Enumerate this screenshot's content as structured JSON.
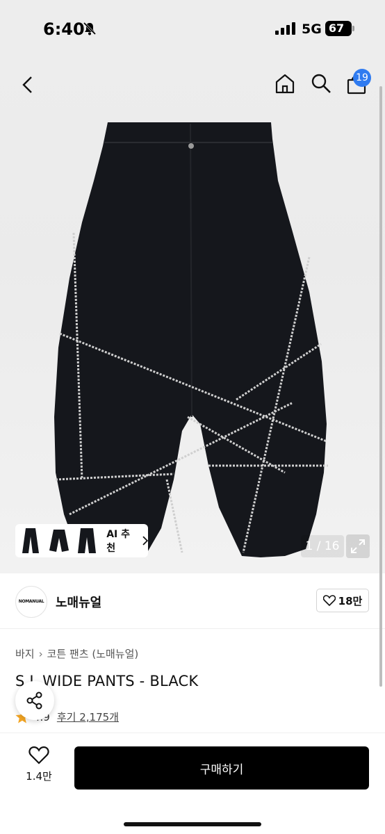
{
  "status": {
    "time": "6:40",
    "network": "5G",
    "battery": "67",
    "battery_level": 0.67
  },
  "header": {
    "cart_count": "19"
  },
  "gallery": {
    "ai_label": "AI 추천",
    "page_indicator": "1 / 16"
  },
  "brand": {
    "name": "노매뉴얼",
    "logo_text": "NOMANUAL",
    "likes": "18만"
  },
  "breadcrumb": [
    "바지",
    "코튼 팬츠 (노매뉴얼)"
  ],
  "product": {
    "title": "S.L WIDE PANTS - BLACK",
    "rating": "4.9",
    "reviews": "후기 2,175개"
  },
  "actions": {
    "wish_count": "1.4만",
    "buy_label": "구매하기"
  },
  "colors": {
    "badge": "#2f7bf0",
    "star": "#f5a623",
    "primary_button": "#000000"
  },
  "icons": [
    "bell-slash-icon",
    "signal-icon",
    "back-icon",
    "home-icon",
    "search-icon",
    "cart-icon",
    "chevron-right-icon",
    "expand-icon",
    "heart-icon",
    "star-icon",
    "share-icon"
  ]
}
